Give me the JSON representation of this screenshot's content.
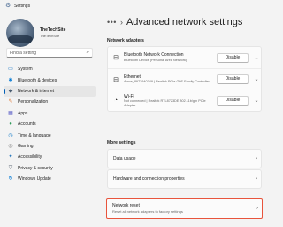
{
  "window": {
    "title": "Settings",
    "app_icon": "settings-app-icon"
  },
  "profile": {
    "name": "TheTechSite",
    "email": "TheTechSite"
  },
  "search": {
    "placeholder": "Find a setting",
    "icon": "search-icon"
  },
  "sidebar": {
    "items": [
      {
        "label": "System",
        "icon": "monitor-icon",
        "color": "#0067c0"
      },
      {
        "label": "Bluetooth & devices",
        "icon": "bluetooth-icon",
        "color": "#0078d4"
      },
      {
        "label": "Network & internet",
        "icon": "wifi-icon",
        "color": "#4a5c70",
        "active": true
      },
      {
        "label": "Personalization",
        "icon": "brush-icon",
        "color": "#e07b39"
      },
      {
        "label": "Apps",
        "icon": "apps-icon",
        "color": "#5b5fc7"
      },
      {
        "label": "Accounts",
        "icon": "person-icon",
        "color": "#2e9a5a"
      },
      {
        "label": "Time & language",
        "icon": "globe-clock-icon",
        "color": "#0a76c6"
      },
      {
        "label": "Gaming",
        "icon": "controller-icon",
        "color": "#6b6b6b"
      },
      {
        "label": "Accessibility",
        "icon": "accessibility-icon",
        "color": "#1b6fb8"
      },
      {
        "label": "Privacy & security",
        "icon": "shield-icon",
        "color": "#5a6370"
      },
      {
        "label": "Windows Update",
        "icon": "update-icon",
        "color": "#0078d4"
      }
    ]
  },
  "header": {
    "more": "•••",
    "separator": "›",
    "title": "Advanced network settings"
  },
  "adapters_section": {
    "label": "Network adapters",
    "items": [
      {
        "name": "Bluetooth Network Connection",
        "desc": "Bluetooth Device (Personal Area Network)",
        "button": "Disable",
        "icon": "network-adapter-icon"
      },
      {
        "name": "Ethernet",
        "desc": "Acme_8973940749 | Realtek PCIe GbE Family Controller",
        "button": "Disable",
        "icon": "ethernet-icon"
      },
      {
        "name": "Wi-Fi",
        "desc": "Not connected | Realtek RTL8723DE 802.11b/g/n PCIe Adapter",
        "button": "Disable",
        "icon": "wifi-icon"
      }
    ]
  },
  "more_section": {
    "label": "More settings",
    "items": [
      {
        "label": "Data usage"
      },
      {
        "label": "Hardware and connection properties"
      }
    ],
    "reset": {
      "label": "Network reset",
      "desc": "Reset all network adapters to factory settings",
      "highlight_color": "#e8543c"
    }
  }
}
